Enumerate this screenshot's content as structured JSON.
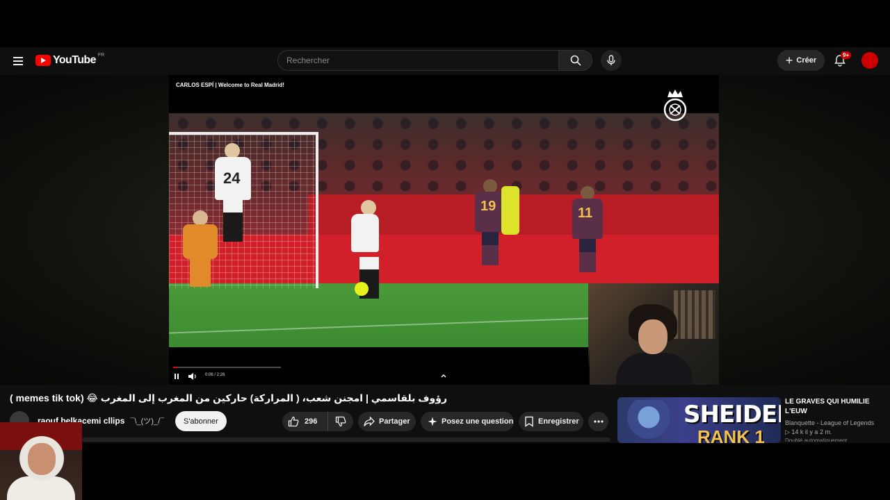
{
  "header": {
    "logo_text": "YouTube",
    "country_code": "FR",
    "search_placeholder": "Rechercher",
    "create_label": "Créer",
    "notification_count": "9+"
  },
  "player": {
    "caption": "CARLOS ESPÍ | Welcome to Real Madrid!",
    "time_display": "0:06 / 2:26",
    "progress": 0.04,
    "shirt_numbers": [
      "24",
      "19",
      "11"
    ]
  },
  "video": {
    "title": "رؤوف بلقاسمي | امجنن شعب، ( المراركة) حاركين من المغرب إلى المغرب 😂 (memes tik tok )",
    "channel_name": "raouf belkacemi cllips",
    "channel_kaomoji": "¯\\_(ツ)_/¯",
    "subscribe_label": "S'abonner",
    "like_count": "296",
    "share_label": "Partager",
    "ask_label": "Posez une question",
    "save_label": "Enregistrer"
  },
  "recommendation": {
    "thumb_text": "SHEIDEN",
    "thumb_text2": "RANK 1",
    "title": "LE GRAVES QUI HUMILIE L'EUW",
    "channel": "Blanquette - League of Legends",
    "meta": "▷ 14 k   il y a 2 m.",
    "extra": "Doublé automatiquement"
  },
  "colors": {
    "brand_red": "#ff0000",
    "background": "#0f0f0f",
    "pill": "#272727"
  }
}
